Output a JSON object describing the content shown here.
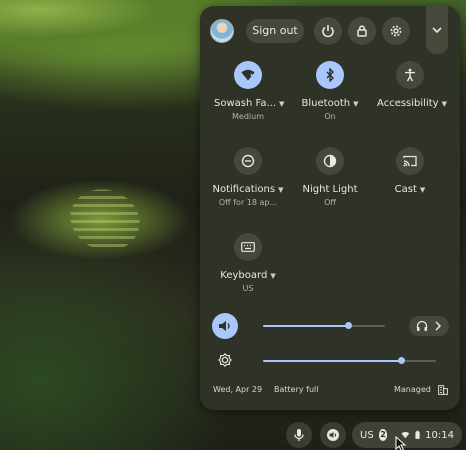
{
  "header": {
    "sign_out_label": "Sign out",
    "power_icon": "power-icon",
    "lock_icon": "lock-icon",
    "settings_icon": "gear-icon",
    "collapse_icon": "chevron-down-icon"
  },
  "tiles": [
    {
      "label": "Sowash Fa...",
      "sublabel": "Medium",
      "icon": "wifi-icon",
      "active": true,
      "has_menu": true
    },
    {
      "label": "Bluetooth",
      "sublabel": "On",
      "icon": "bluetooth-icon",
      "active": true,
      "has_menu": true
    },
    {
      "label": "Accessibility",
      "sublabel": "",
      "icon": "accessibility-icon",
      "active": false,
      "has_menu": true
    },
    {
      "label": "Notifications",
      "sublabel": "Off for 18 ap...",
      "icon": "notifications-off-icon",
      "active": false,
      "has_menu": true
    },
    {
      "label": "Night Light",
      "sublabel": "Off",
      "icon": "night-light-icon",
      "active": false,
      "has_menu": false
    },
    {
      "label": "Cast",
      "sublabel": "",
      "icon": "cast-icon",
      "active": false,
      "has_menu": true
    },
    {
      "label": "Keyboard",
      "sublabel": "US",
      "icon": "keyboard-icon",
      "active": false,
      "has_menu": true
    }
  ],
  "sliders": {
    "volume": {
      "value": 0.7,
      "icon": "volume-icon"
    },
    "brightness": {
      "value": 0.8,
      "icon": "brightness-icon"
    }
  },
  "footer": {
    "date": "Wed, Apr 29",
    "battery": "Battery full",
    "managed": "Managed"
  },
  "shelf": {
    "ime": "US",
    "notification_count": "2",
    "time": "10:14"
  },
  "colors": {
    "accent": "#a8c7fa",
    "panel": "#2f3226"
  }
}
